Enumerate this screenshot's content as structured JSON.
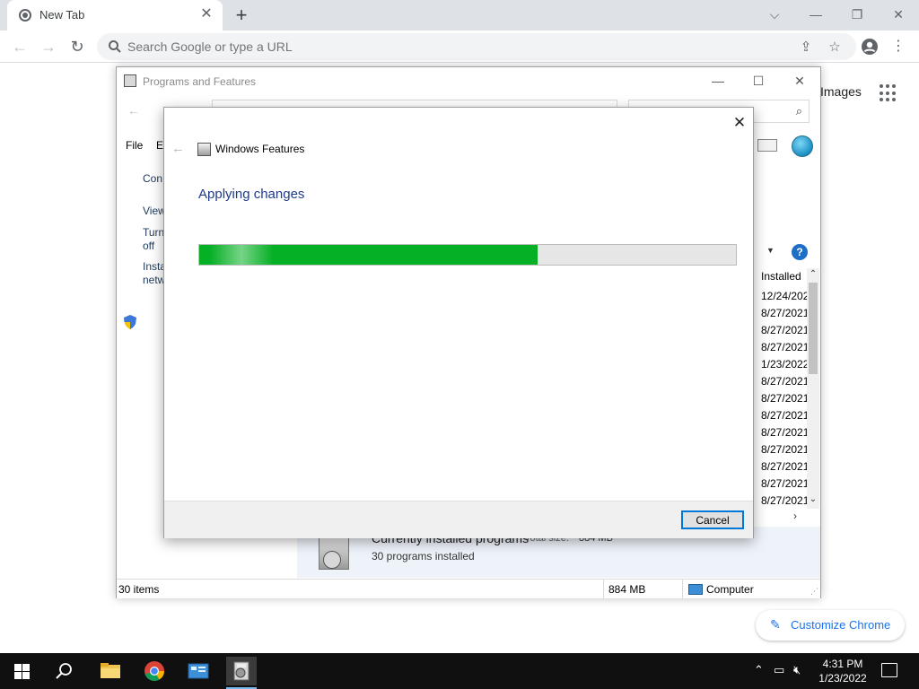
{
  "browser": {
    "tab_title": "New Tab",
    "omnibox_placeholder": "Search Google or type a URL",
    "ntp_images_link": "Images",
    "customize_label": "Customize Chrome"
  },
  "programs_window": {
    "title": "Programs and Features",
    "menu_file": "File",
    "menu_edit": "E",
    "sidebar_links": [
      "Con",
      "View",
      "Turn",
      "off",
      "Insta",
      "netw"
    ],
    "column_installed": "Installed",
    "installed_dates": [
      "12/24/202",
      "8/27/2021",
      "8/27/2021",
      "8/27/2021",
      "1/23/2022",
      "8/27/2021",
      "8/27/2021",
      "8/27/2021",
      "8/27/2021",
      "8/27/2021",
      "8/27/2021",
      "8/27/2021",
      "8/27/2021"
    ],
    "details_title": "Currently installed programs",
    "details_size_label": "Total size:",
    "details_size_value": "884 MB",
    "details_count": "30 programs installed",
    "status_items": "30 items",
    "status_size": "884 MB",
    "status_location": "Computer"
  },
  "features_dialog": {
    "title": "Windows Features",
    "heading": "Applying changes",
    "progress": 0.63,
    "cancel_label": "Cancel"
  },
  "taskbar": {
    "clock_time": "4:31 PM",
    "clock_date": "1/23/2022"
  }
}
